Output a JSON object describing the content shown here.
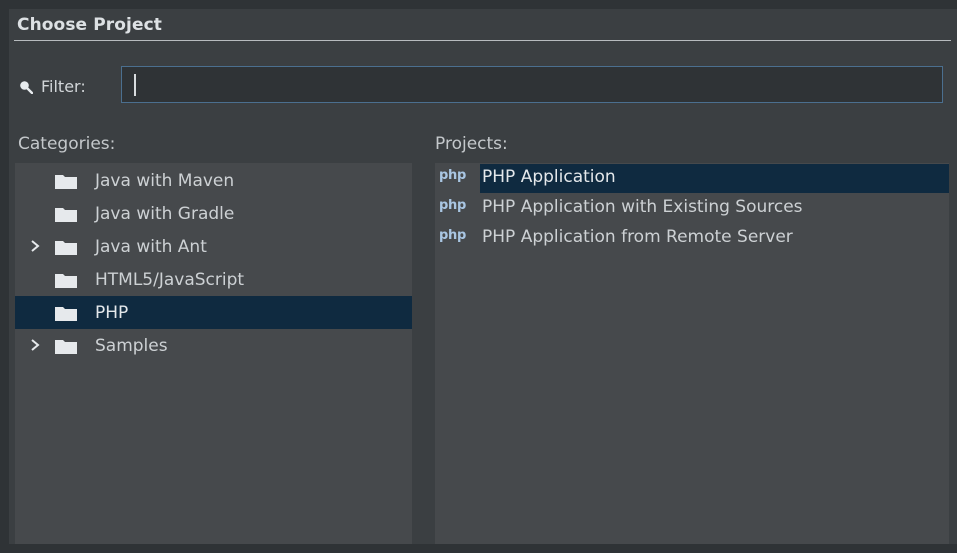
{
  "dialog": {
    "title": "Choose Project"
  },
  "filter": {
    "label": "Filter:",
    "value": "",
    "placeholder": ""
  },
  "categories": {
    "label": "Categories:",
    "items": [
      {
        "label": "Java with Maven",
        "expandable": false,
        "selected": false
      },
      {
        "label": "Java with Gradle",
        "expandable": false,
        "selected": false
      },
      {
        "label": "Java with Ant",
        "expandable": true,
        "selected": false
      },
      {
        "label": "HTML5/JavaScript",
        "expandable": false,
        "selected": false
      },
      {
        "label": "PHP",
        "expandable": false,
        "selected": true
      },
      {
        "label": "Samples",
        "expandable": true,
        "selected": false
      }
    ]
  },
  "projects": {
    "label": "Projects:",
    "icon_text": "php",
    "items": [
      {
        "label": "PHP Application",
        "selected": true
      },
      {
        "label": "PHP Application with Existing Sources",
        "selected": false
      },
      {
        "label": "PHP Application from Remote Server",
        "selected": false
      }
    ]
  },
  "colors": {
    "selection": "#0f2a40",
    "panel": "#46494c",
    "background": "#3b3f42",
    "input_border": "#4b6f8f"
  },
  "icons": {
    "filter": "search-icon",
    "category": "folder-icon",
    "expander": "chevron-right-icon",
    "project": "php-icon"
  }
}
